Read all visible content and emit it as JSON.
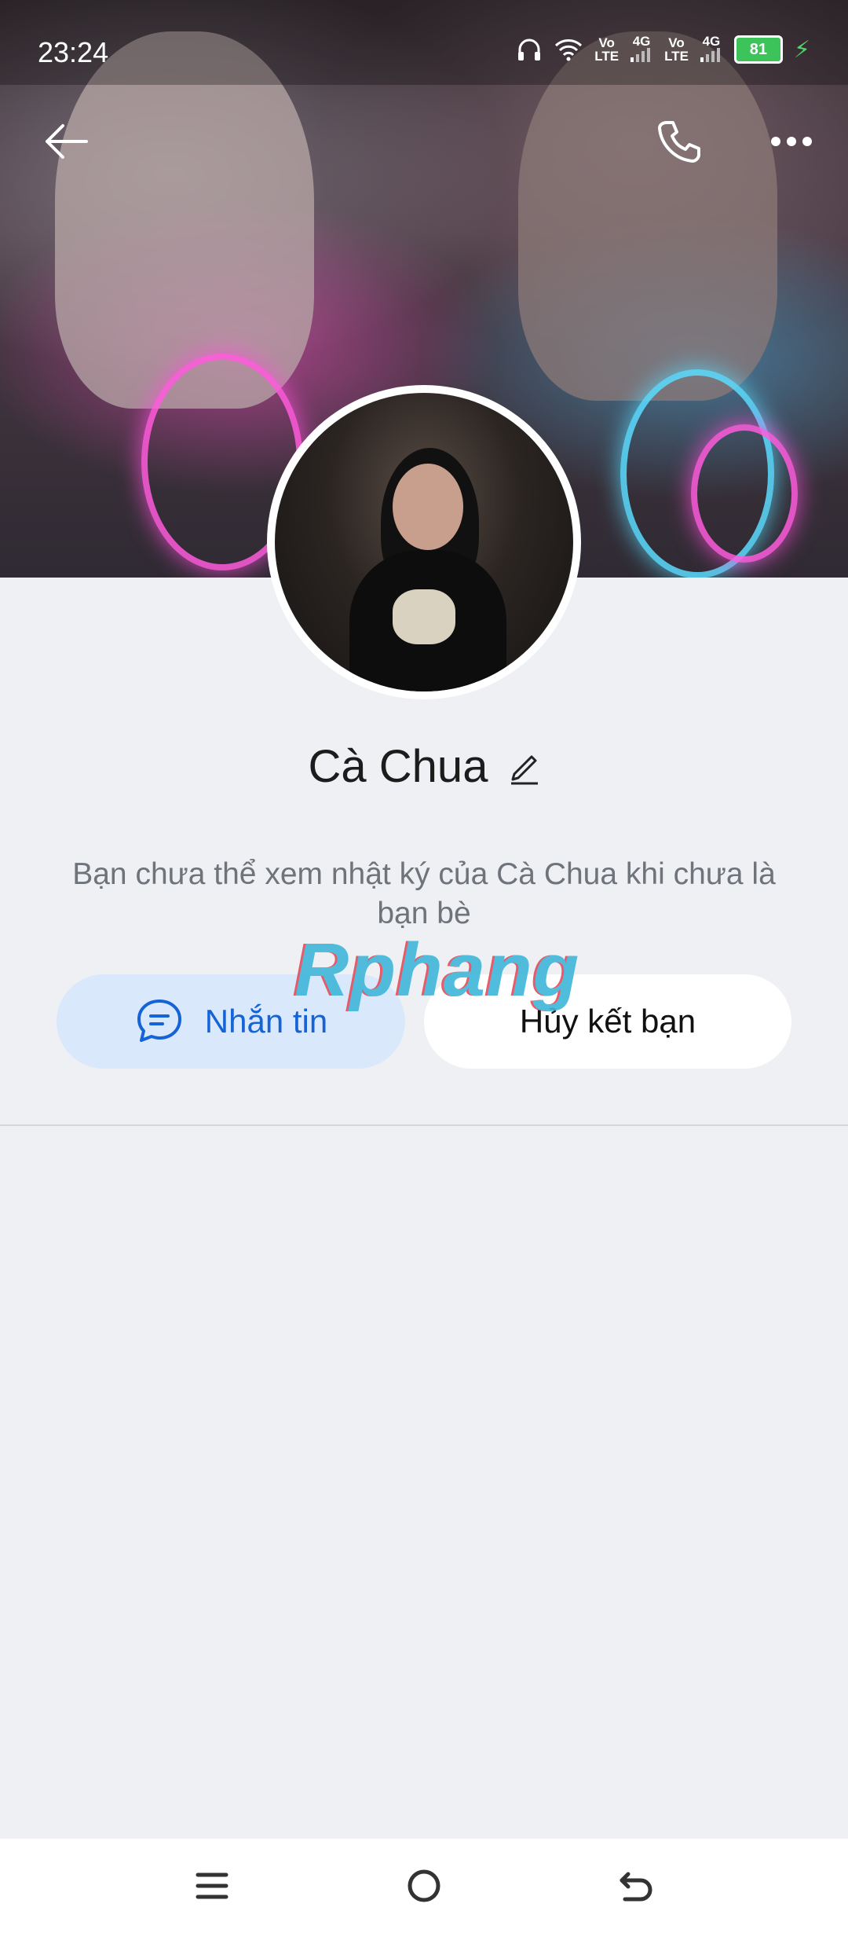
{
  "status_bar": {
    "time": "23:24",
    "volte_1_top": "Vo",
    "volte_1_bottom": "LTE",
    "network_1": "4G",
    "volte_2_top": "Vo",
    "volte_2_bottom": "LTE",
    "network_2": "4G",
    "battery": "81"
  },
  "profile": {
    "name": "Cà Chua",
    "info_text": "Bạn chưa thể xem nhật ký của Cà Chua khi chưa là bạn bè"
  },
  "actions": {
    "message_label": "Nhắn tin",
    "unfriend_label": "Hủy kết bạn"
  },
  "watermark": {
    "text": "Rphang"
  },
  "icons": {
    "back": "arrow-left-icon",
    "call": "phone-icon",
    "more": "more-dots-icon",
    "edit": "pencil-icon",
    "message": "chat-bubble-icon",
    "nav_menu": "menu-icon",
    "nav_home": "home-circle-icon",
    "nav_back": "back-return-icon"
  },
  "colors": {
    "primary_blue": "#1563d6",
    "message_button_bg": "#d9e9fb",
    "page_bg": "#eff0f4",
    "battery_green": "#3cc45a"
  }
}
